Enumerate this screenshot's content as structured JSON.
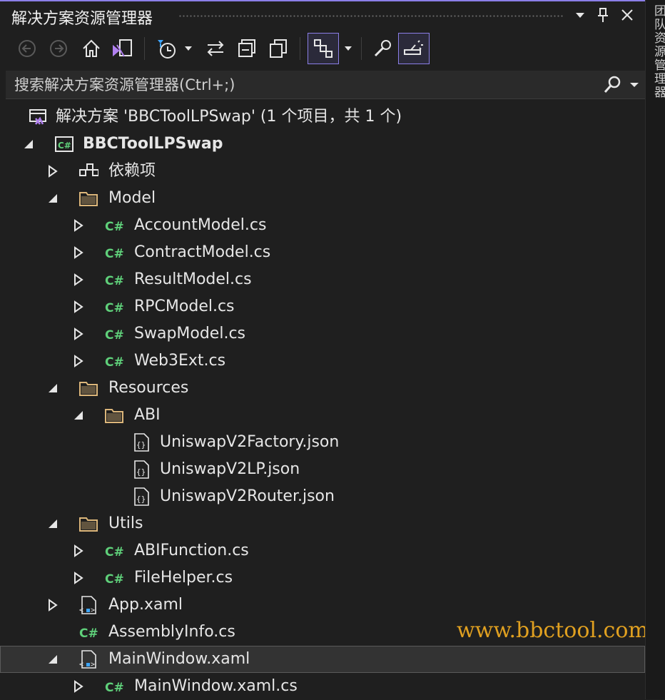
{
  "window": {
    "title": "解决方案资源管理器",
    "side_tab": "团队资源管理器"
  },
  "colors": {
    "accent": "#8b7fe8",
    "background": "#1f1f1f",
    "csharp_green": "#5fd07a",
    "folder_yellow": "#dcb67a",
    "watermark": "#e0a020"
  },
  "search": {
    "placeholder": "搜索解决方案资源管理器(Ctrl+;)"
  },
  "tree": {
    "solution": "解决方案 'BBCToolLPSwap' (1 个项目，共 1 个)",
    "project": "BBCToolLPSwap",
    "dependencies": "依赖项",
    "model_folder": "Model",
    "model_files": [
      "AccountModel.cs",
      "ContractModel.cs",
      "ResultModel.cs",
      "RPCModel.cs",
      "SwapModel.cs",
      "Web3Ext.cs"
    ],
    "resources_folder": "Resources",
    "abi_folder": "ABI",
    "abi_files": [
      "UniswapV2Factory.json",
      "UniswapV2LP.json",
      "UniswapV2Router.json"
    ],
    "utils_folder": "Utils",
    "utils_files": [
      "ABIFunction.cs",
      "FileHelper.cs"
    ],
    "app_xaml": "App.xaml",
    "assembly_info": "AssemblyInfo.cs",
    "main_window": "MainWindow.xaml",
    "main_window_cs": "MainWindow.xaml.cs"
  },
  "watermark": "www.bbctool.com"
}
